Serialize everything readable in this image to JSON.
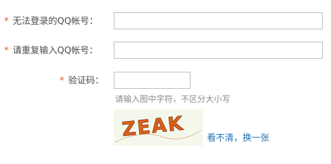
{
  "form": {
    "fields": [
      {
        "required_mark": "*",
        "label": "无法登录的QQ帐号：",
        "value": ""
      },
      {
        "required_mark": "*",
        "label": "请重复输入QQ帐号：",
        "value": ""
      },
      {
        "required_mark": "*",
        "label": "验证码：",
        "value": ""
      }
    ],
    "captcha": {
      "hint": "请输入图中字符，不区分大小写",
      "image_text": "ZEAK",
      "refresh_label": "看不清，换一张"
    }
  },
  "colors": {
    "required": "#e2541b",
    "link": "#1f6fb5",
    "captcha_text": "#d9611c",
    "input_border": "#bdbdbd"
  }
}
